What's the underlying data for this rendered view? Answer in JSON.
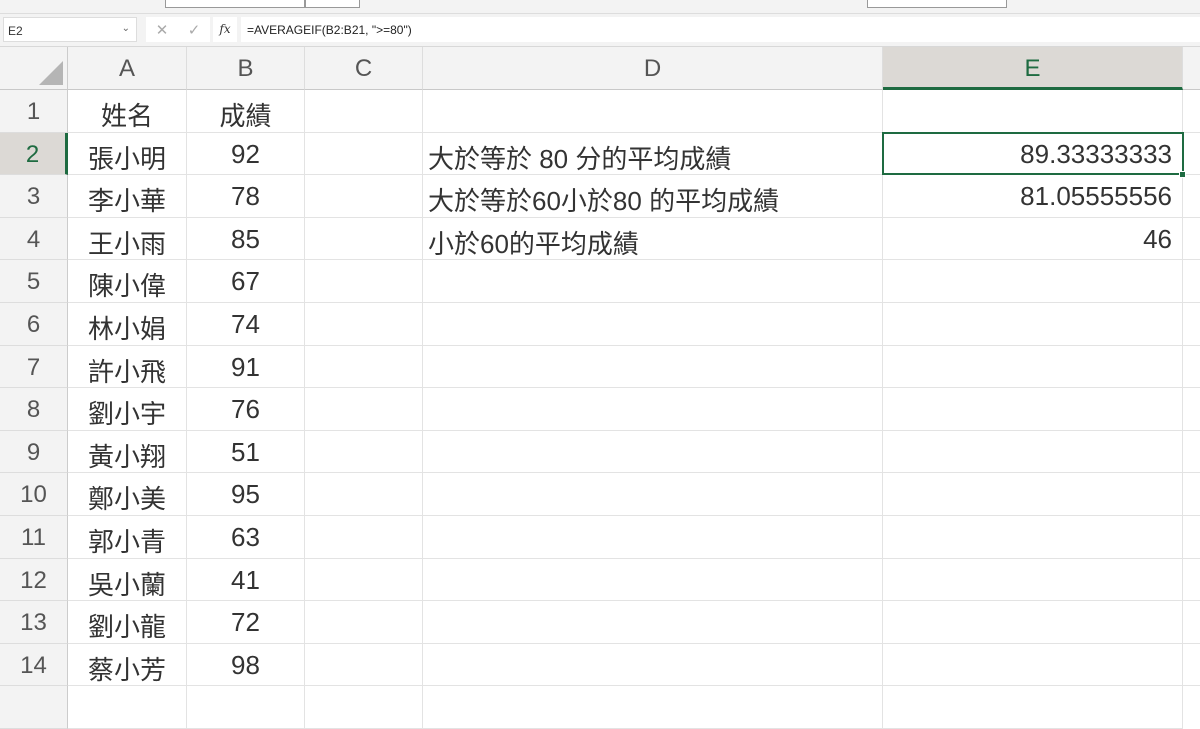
{
  "name_box": "E2",
  "formula": "=AVERAGEIF(B2:B21, \">=80\")",
  "columns": [
    "A",
    "B",
    "C",
    "D",
    "E"
  ],
  "rows": [
    {
      "n": "1",
      "a": "姓名",
      "b": "成績",
      "d": "",
      "e": ""
    },
    {
      "n": "2",
      "a": "張小明",
      "b": "92",
      "d": "大於等於 80 分的平均成績",
      "e": "89.33333333"
    },
    {
      "n": "3",
      "a": "李小華",
      "b": "78",
      "d": "大於等於60小於80 的平均成績",
      "e": "81.05555556"
    },
    {
      "n": "4",
      "a": "王小雨",
      "b": "85",
      "d": "小於60的平均成績",
      "e": "46"
    },
    {
      "n": "5",
      "a": "陳小偉",
      "b": "67",
      "d": "",
      "e": ""
    },
    {
      "n": "6",
      "a": "林小娟",
      "b": "74",
      "d": "",
      "e": ""
    },
    {
      "n": "7",
      "a": "許小飛",
      "b": "91",
      "d": "",
      "e": ""
    },
    {
      "n": "8",
      "a": "劉小宇",
      "b": "76",
      "d": "",
      "e": ""
    },
    {
      "n": "9",
      "a": "黃小翔",
      "b": "51",
      "d": "",
      "e": ""
    },
    {
      "n": "10",
      "a": "鄭小美",
      "b": "95",
      "d": "",
      "e": ""
    },
    {
      "n": "11",
      "a": "郭小青",
      "b": "63",
      "d": "",
      "e": ""
    },
    {
      "n": "12",
      "a": "吳小蘭",
      "b": "41",
      "d": "",
      "e": ""
    },
    {
      "n": "13",
      "a": "劉小龍",
      "b": "72",
      "d": "",
      "e": ""
    },
    {
      "n": "14",
      "a": "蔡小芳",
      "b": "98",
      "d": "",
      "e": ""
    }
  ]
}
